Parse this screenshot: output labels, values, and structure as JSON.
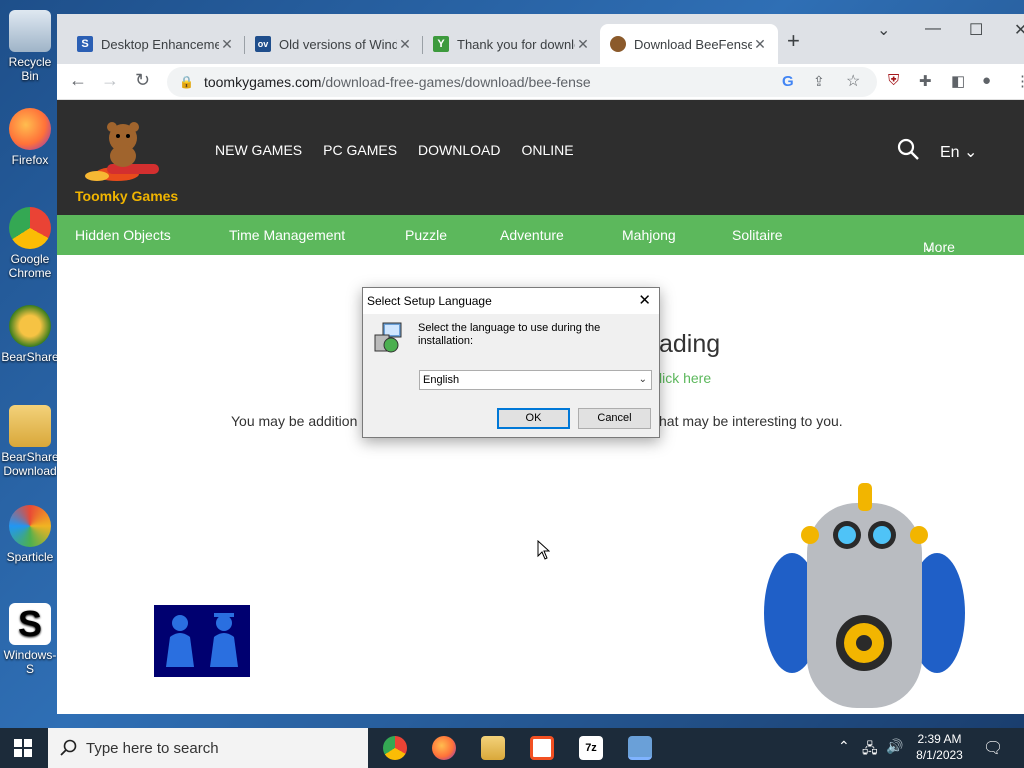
{
  "desktop": {
    "icons": [
      {
        "label": "Recycle Bin",
        "color": "#b8c7d6"
      },
      {
        "label": "Firefox",
        "color": "#ff7139"
      },
      {
        "label": "Google Chrome",
        "color": "#4285f4"
      },
      {
        "label": "BearShare",
        "color": "#3a7d1e"
      },
      {
        "label": "BearShare Download",
        "color": "#e8b93a"
      },
      {
        "label": "Sparticle",
        "color": "#f1b322"
      },
      {
        "label": "Windows-S",
        "color": "#ffffff"
      }
    ]
  },
  "browser": {
    "tabs": [
      {
        "title": "Desktop Enhancements",
        "fav_text": "S",
        "fav_color": "#2b5fb4"
      },
      {
        "title": "Old versions of Windows",
        "fav_text": "ov",
        "fav_color": "#1f4e8c"
      },
      {
        "title": "Thank you for downloading",
        "fav_text": "Y",
        "fav_color": "#3d9a3d"
      },
      {
        "title": "Download BeeFense",
        "fav_text": "",
        "fav_color": "#8b5a2b"
      }
    ],
    "new_tab": "+",
    "url_host": "toomkygames.com",
    "url_path": "/download-free-games/download/bee-fense"
  },
  "site": {
    "logo_text": "Toomky Games",
    "nav": [
      "NEW GAMES",
      "PC GAMES",
      "DOWNLOAD",
      "ONLINE"
    ],
    "language": "En",
    "categories": [
      "Hidden Objects",
      "Time Management",
      "Puzzle",
      "Adventure",
      "Mahjong",
      "Solitaire"
    ],
    "more_label": "More",
    "heading_fragment": "ading",
    "link_fragment": "lick here",
    "line_left": "You may be addition",
    "line_right": "hat may be interesting to you.",
    "accent": "#5cb85c"
  },
  "dialog": {
    "title": "Select Setup Language",
    "message": "Select the language to use during the installation:",
    "selected_language": "English",
    "ok_label": "OK",
    "cancel_label": "Cancel"
  },
  "taskbar": {
    "search_placeholder": "Type here to search",
    "time": "2:39 AM",
    "date": "8/1/2023"
  }
}
